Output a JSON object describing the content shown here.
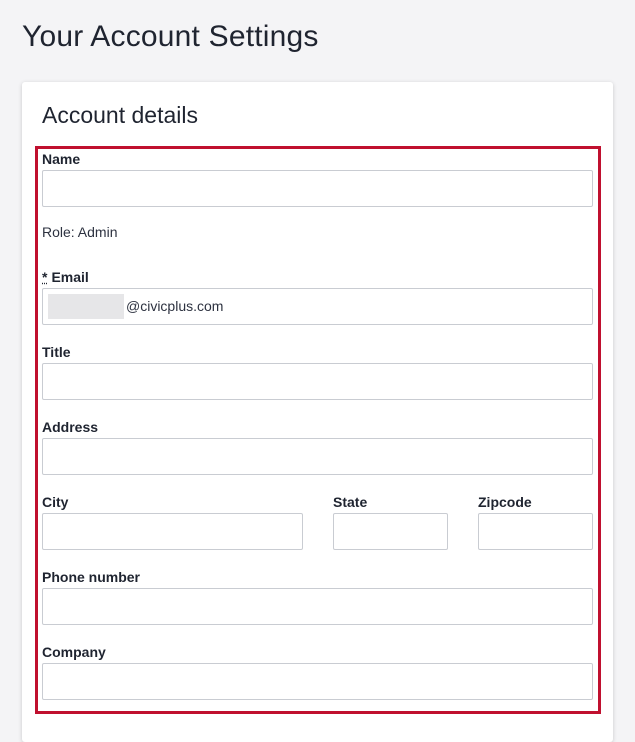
{
  "page": {
    "title": "Your Account Settings"
  },
  "card": {
    "title": "Account details",
    "highlight_color": "#c0102f"
  },
  "fields": {
    "name": {
      "label": "Name",
      "value": ""
    },
    "role": {
      "text": "Role: Admin"
    },
    "email": {
      "required_marker": "*",
      "label": "Email",
      "value": "@civicplus.com"
    },
    "title": {
      "label": "Title",
      "value": ""
    },
    "address": {
      "label": "Address",
      "value": ""
    },
    "city": {
      "label": "City",
      "value": ""
    },
    "state": {
      "label": "State",
      "value": ""
    },
    "zipcode": {
      "label": "Zipcode",
      "value": ""
    },
    "phone": {
      "label": "Phone number",
      "value": ""
    },
    "company": {
      "label": "Company",
      "value": ""
    }
  }
}
